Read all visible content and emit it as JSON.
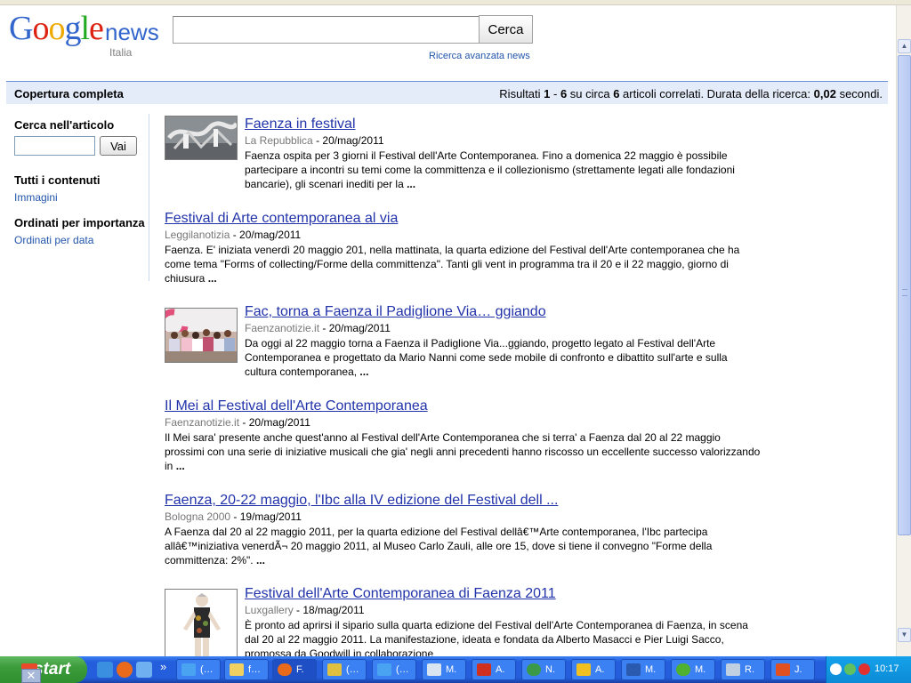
{
  "header": {
    "logo_letters": [
      "G",
      "o",
      "o",
      "g",
      "l",
      "e"
    ],
    "logo_news": "news",
    "logo_sub": "Italia",
    "search_value": "",
    "search_button": "Cerca",
    "advanced_link": "Ricerca avanzata news"
  },
  "result_bar": {
    "title": "Copertura completa",
    "stats_prefix": "Risultati ",
    "range_start": "1",
    "range_sep": " - ",
    "range_end": "6",
    "stats_mid1": " su circa ",
    "total": "6",
    "stats_mid2": " articoli correlati. Durata della ricerca: ",
    "duration": "0,02",
    "stats_suffix": " secondi."
  },
  "sidebar": {
    "search_heading": "Cerca nell'articolo",
    "search_button": "Vai",
    "all_content": "Tutti i contenuti",
    "images_link": "Immagini",
    "order_heading": "Ordinati per importanza",
    "order_link": "Ordinati per data"
  },
  "articles": [
    {
      "title": "Faenza in festival",
      "source": "La Repubblica",
      "date": " - 20/mag/2011",
      "snippet": "Faenza ospita per 3 giorni il Festival dell'Arte Contemporanea. Fino a domenica 22 maggio è possibile partecipare a incontri su temi come la committenza e il collezionismo (strettamente legati alle fondazioni bancarie), gli scenari inediti per la ",
      "ellipsis": "..."
    },
    {
      "title": "Festival di Arte contemporanea al via",
      "source": "Leggilanotizia",
      "date": " - 20/mag/2011",
      "snippet": "Faenza. E' iniziata venerdì 20 maggio 201, nella mattinata, la quarta edizione del Festival dell'Arte contemporanea che ha come tema \"Forms of collecting/Forme della committenza\". Tanti gli vent in programma tra il 20 e il 22 maggio, giorno di chiusura ",
      "ellipsis": "..."
    },
    {
      "title": "Fac, torna a Faenza il Padiglione Via… ggiando",
      "source": "Faenzanotizie.it",
      "date": " - 20/mag/2011",
      "snippet": "Da oggi al 22 maggio torna a Faenza il Padiglione Via...ggiando, progetto legato al Festival dell'Arte Contemporanea e progettato da Mario Nanni come sede mobile di confronto e dibattito sull'arte e sulla cultura contemporanea, ",
      "ellipsis": "..."
    },
    {
      "title": "Il Mei al Festival dell'Arte Contemporanea",
      "source": "Faenzanotizie.it",
      "date": " - 20/mag/2011",
      "snippet": "Il Mei sara' presente anche quest'anno al Festival dell'Arte Contemporanea che si terra' a Faenza dal 20 al 22 maggio prossimi con una serie di iniziative musicali che gia' negli anni precedenti hanno riscosso un eccellente successo valorizzando in ",
      "ellipsis": "..."
    },
    {
      "title": "Faenza, 20-22 maggio, l'Ibc alla IV edizione del Festival dell ...",
      "source": "Bologna 2000",
      "date": " - 19/mag/2011",
      "snippet": "A Faenza dal 20 al 22 maggio 2011, per la quarta edizione del Festival dellâ€™Arte contemporanea, l'Ibc partecipa allâ€™iniziativa venerdÃ¬ 20 maggio 2011, al Museo Carlo Zauli, alle ore 15, dove si tiene il convegno \"Forme della committenza: 2%\". ",
      "ellipsis": "..."
    },
    {
      "title": "Festival dell'Arte Contemporanea di Faenza 2011",
      "source": "Luxgallery",
      "date": " - 18/mag/2011",
      "snippet": "È pronto ad aprirsi il sipario sulla quarta edizione del Festival dell'Arte Contemporanea di Faenza, in scena dal 20 al 22 maggio 2011. La manifestazione, ideata e fondata da Alberto Masacci e Pier Luigi Sacco, promossa da Goodwill in collaborazione",
      "ellipsis": ""
    }
  ],
  "taskbar": {
    "start": "start",
    "close_glyph": "✕",
    "more_glyph": "»",
    "items": [
      "(…",
      "f…",
      "F.",
      "(…",
      "(…",
      "M.",
      "A.",
      "N.",
      "A.",
      "M.",
      "M.",
      "R.",
      "J."
    ],
    "clock": "10:17"
  },
  "scrollbar": {
    "up_glyph": "▲",
    "down_glyph": "▼"
  },
  "colors": {
    "link": "#2233aa",
    "bar_bg": "#e5ecf9",
    "bar_border": "#6b90da",
    "taskbar": "#245edc",
    "start": "#3c9c3c"
  }
}
